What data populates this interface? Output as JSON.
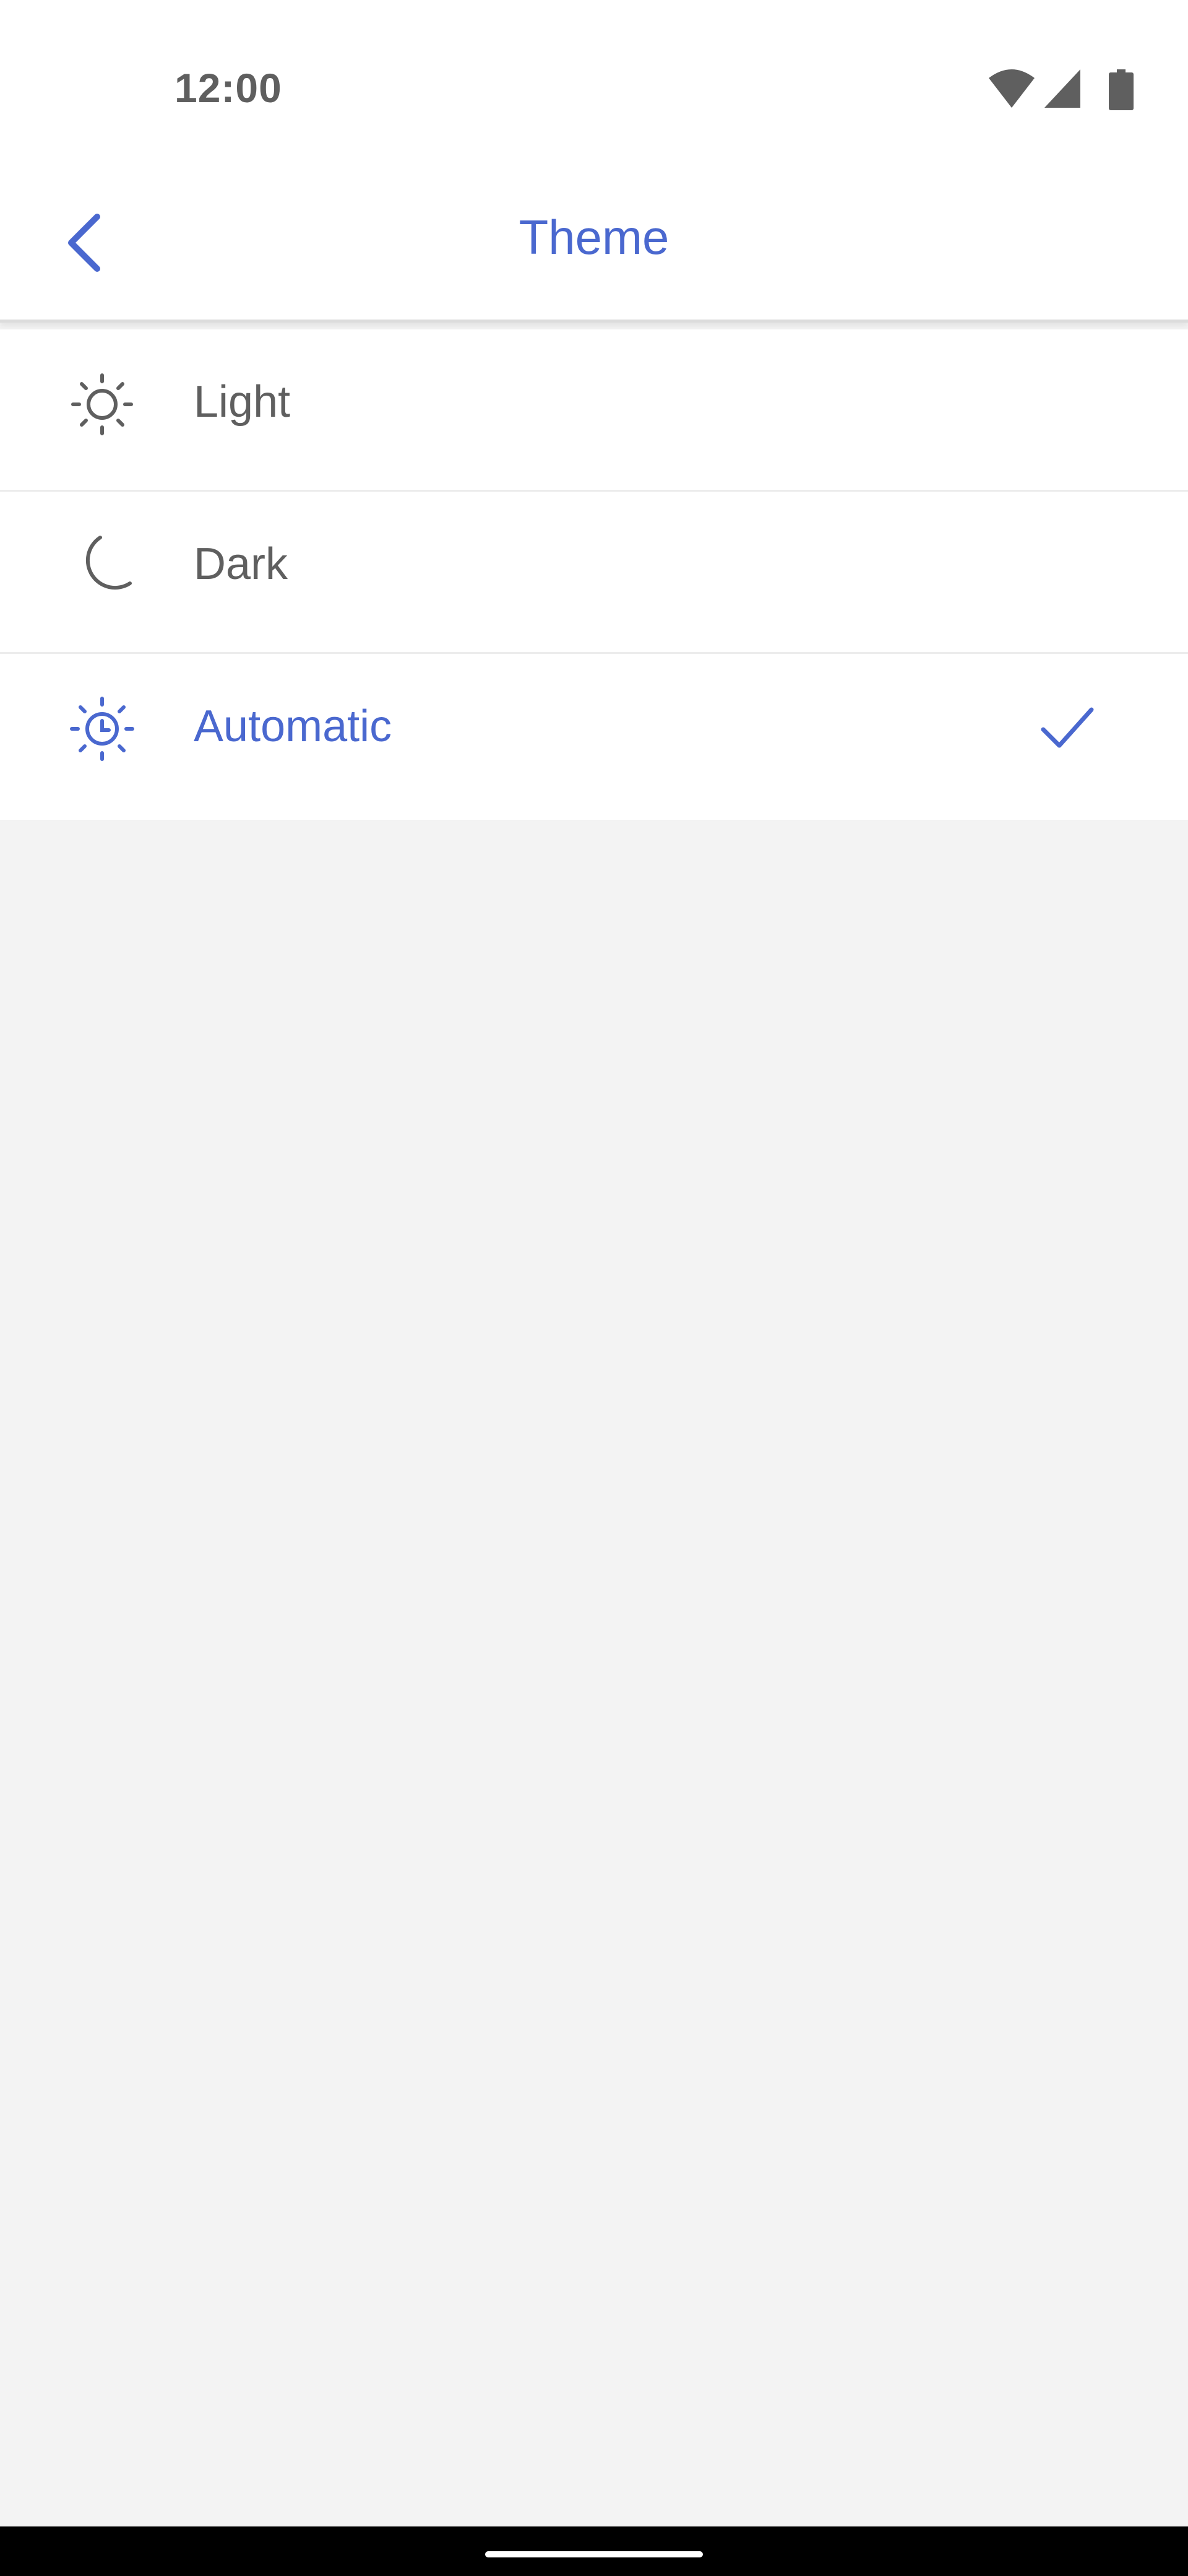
{
  "status_bar": {
    "time": "12:00",
    "icons": [
      "wifi-icon",
      "cellular-signal-icon",
      "battery-icon"
    ]
  },
  "app_bar": {
    "title": "Theme",
    "back_icon": "chevron-left-icon"
  },
  "theme_options": [
    {
      "label": "Light",
      "icon": "sun-icon",
      "selected": false
    },
    {
      "label": "Dark",
      "icon": "moon-icon",
      "selected": false
    },
    {
      "label": "Automatic",
      "icon": "sun-clock-icon",
      "selected": true
    }
  ],
  "colors": {
    "accent": "#4a68cf",
    "text": "#5f5f5f",
    "background": "#f3f3f3",
    "surface": "#ffffff"
  }
}
